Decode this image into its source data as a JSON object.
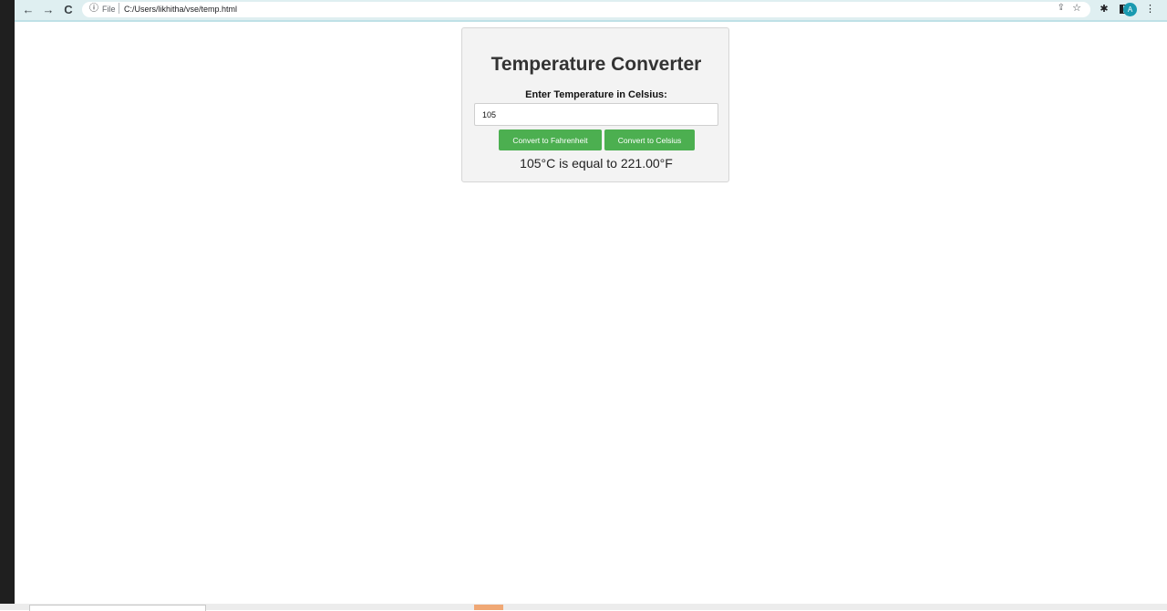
{
  "browser": {
    "back_icon": "←",
    "forward_icon": "→",
    "reload_icon": "C",
    "info_icon": "ⓘ",
    "scheme": "File",
    "url": "C:/Users/likhitha/vse/temp.html",
    "share_icon": "⇪",
    "bookmark_icon": "☆",
    "extensions_icon": "✱",
    "profile_initial": "A",
    "menu_icon": "⋮"
  },
  "converter": {
    "title": "Temperature Converter",
    "input_label": "Enter Temperature in Celsius:",
    "input_value": "105",
    "to_fahrenheit_label": "Convert to Fahrenheit",
    "to_celsius_label": "Convert to Celsius",
    "result_text": "105°C is equal to 221.00°F"
  },
  "colors": {
    "button": "#4caf50",
    "card_background": "#f3f3f3",
    "browser_bar": "#dfeff1"
  }
}
